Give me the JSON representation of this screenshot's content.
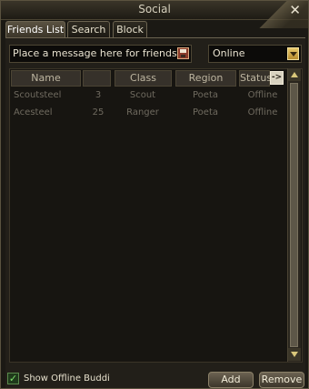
{
  "window": {
    "title": "Social"
  },
  "tabs": [
    {
      "label": "Friends List",
      "active": true
    },
    {
      "label": "Search",
      "active": false
    },
    {
      "label": "Block",
      "active": false
    }
  ],
  "message": {
    "placeholder": "Place a message here for friends"
  },
  "status_select": {
    "value": "Online"
  },
  "table": {
    "columns": [
      "Name",
      "",
      "Class",
      "Region",
      "Status"
    ],
    "rows": [
      [
        "Scoutsteel",
        "3",
        "Scout",
        "Poeta",
        "Offline"
      ],
      [
        "Acesteel",
        "25",
        "Ranger",
        "Poeta",
        "Offline"
      ]
    ]
  },
  "footer": {
    "show_offline_label": "Show Offline Buddies",
    "show_offline_checked": true,
    "add_label": "Add",
    "remove_label": "Remove"
  },
  "colors": {
    "accent": "#d9c77a",
    "text_dim": "#6f6a5f"
  }
}
